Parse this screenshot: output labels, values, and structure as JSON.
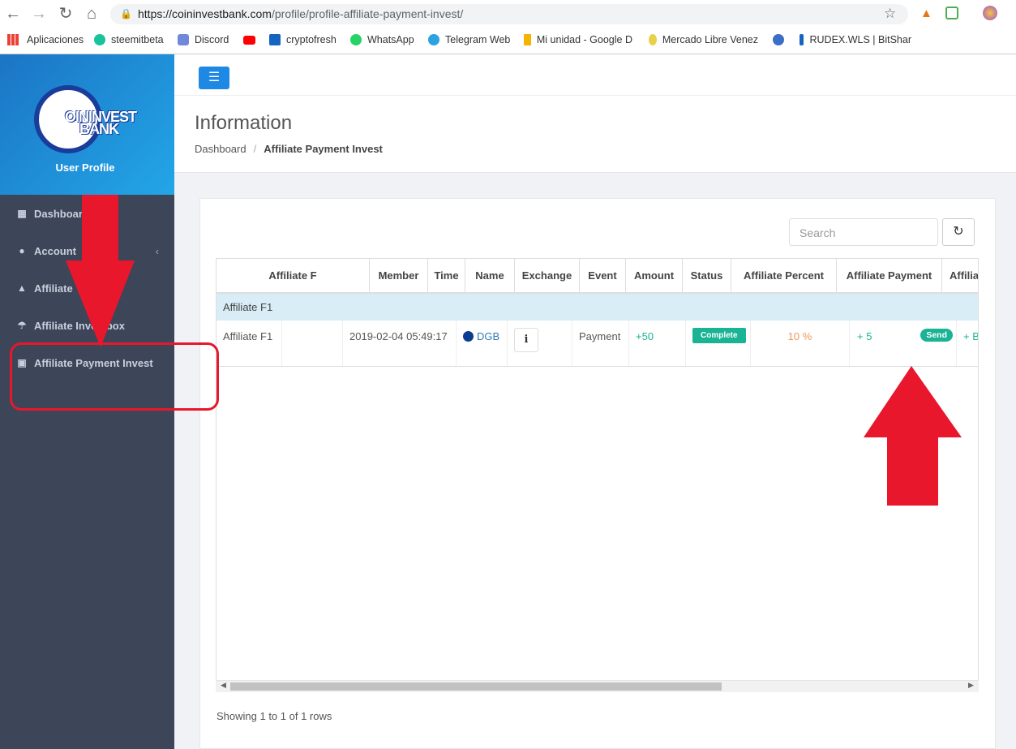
{
  "browser": {
    "url_main": "https://coininvestbank.com",
    "url_path": "/profile/profile-affiliate-payment-invest/",
    "bookmarks": [
      {
        "label": "Aplicaciones",
        "color": "#e94235"
      },
      {
        "label": "steemitbeta",
        "color": "#19c39c"
      },
      {
        "label": "Discord",
        "color": "#7289da"
      },
      {
        "label": "",
        "color": "#ff0000"
      },
      {
        "label": "cryptofresh",
        "color": "#1565c0"
      },
      {
        "label": "WhatsApp",
        "color": "#25d366"
      },
      {
        "label": "Telegram Web",
        "color": "#2aa3df"
      },
      {
        "label": "Mi unidad - Google D",
        "color": "#f4b400"
      },
      {
        "label": "Mercado Libre Venez",
        "color": "#e8d04a"
      },
      {
        "label": "",
        "color": "#3b6fc7"
      },
      {
        "label": "RUDEX.WLS | BitShar",
        "color": "#1565c0"
      }
    ]
  },
  "sidebar": {
    "logo_text_line1": "OININVEST",
    "logo_text_line2": "BANK",
    "user_profile": "User Profile",
    "items": [
      {
        "label": "Dashboard",
        "icon": "dashboard-icon"
      },
      {
        "label": "Account",
        "icon": "user-icon"
      },
      {
        "label": "Affiliate",
        "icon": "affiliate-icon"
      },
      {
        "label": "Affiliate Investbox",
        "icon": "umbrella-icon"
      },
      {
        "label": "Affiliate Payment Invest",
        "icon": "money-icon"
      }
    ]
  },
  "header": {
    "title": "Information",
    "breadcrumb_root": "Dashboard",
    "breadcrumb_current": "Affiliate Payment Invest"
  },
  "toolbar": {
    "search_placeholder": "Search"
  },
  "table": {
    "columns": [
      "Affiliate F",
      "Member",
      "Time",
      "Name",
      "Exchange",
      "Event",
      "Amount",
      "Status",
      "Affiliate Percent",
      "Affiliate Payment",
      "Affilia"
    ],
    "group_label": "Affiliate F1",
    "row": {
      "affiliate": "Affiliate F1",
      "member": "",
      "time": "2019-02-04 05:49:17",
      "name": "DGB",
      "exchange_icon": "info-icon",
      "event": "Payment",
      "amount": "+50",
      "status": "Complete",
      "affiliate_percent": "10 %",
      "affiliate_payment": "+ 5",
      "send_label": "Send",
      "affilia_extra": "+ B"
    }
  },
  "footer": {
    "showing": "Showing 1 to 1 of 1 rows"
  },
  "colors": {
    "sidebar_bg": "#3d4559",
    "accent_blue": "#1e88e5",
    "success_green": "#1ab394",
    "percent_orange": "#f0965a",
    "annotation_red": "#e8172b"
  }
}
